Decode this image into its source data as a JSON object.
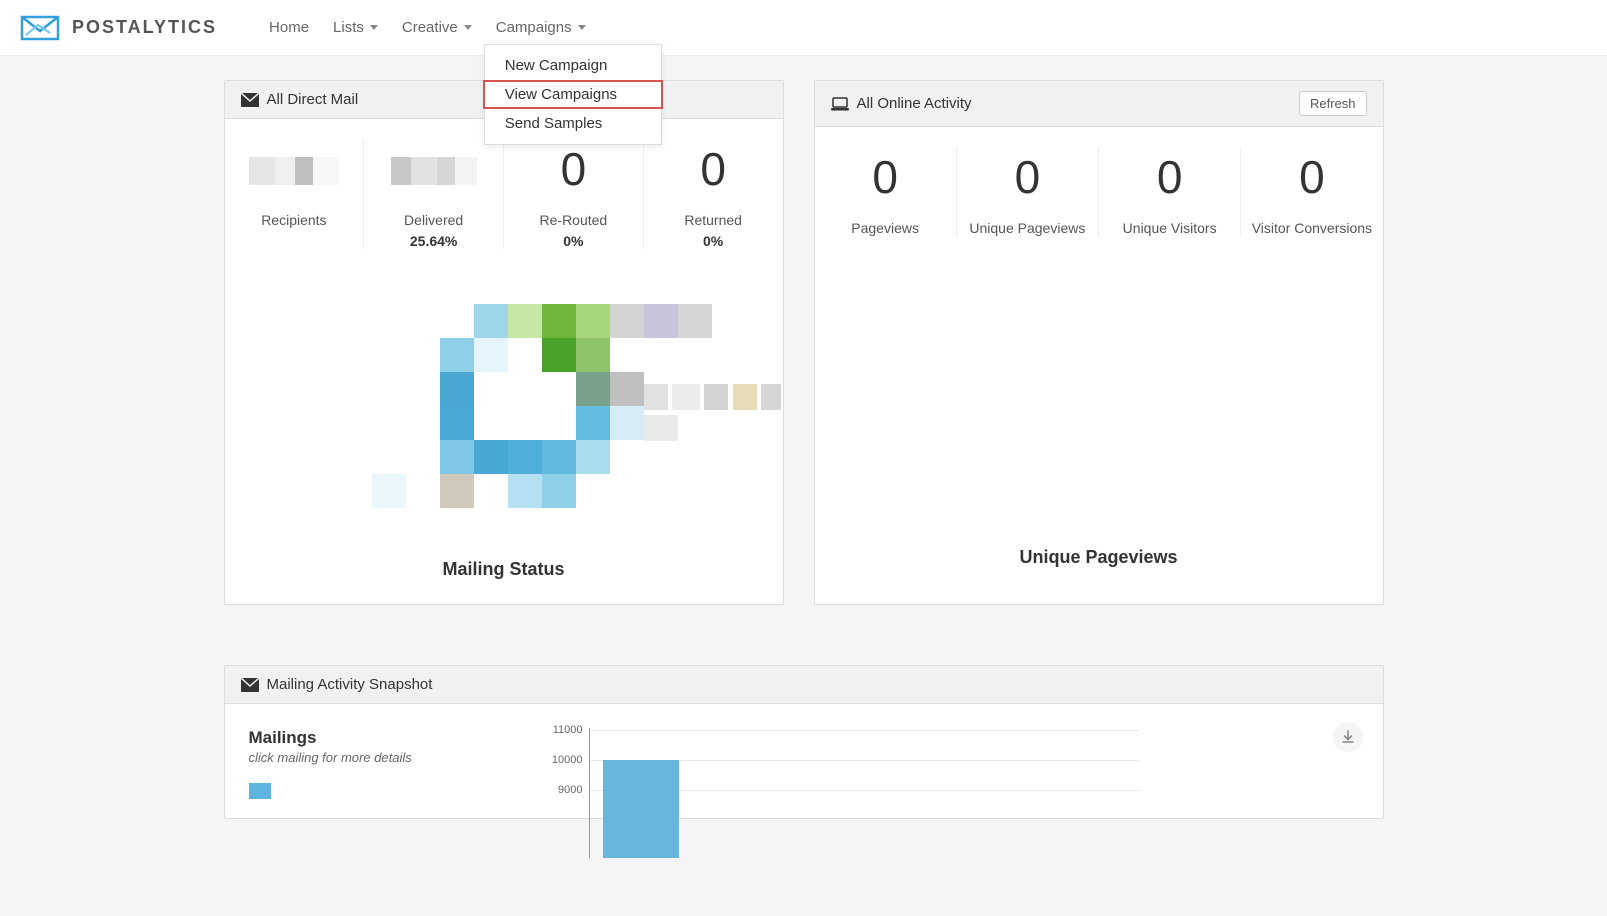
{
  "brand": "POSTALYTICS",
  "nav": {
    "items": [
      {
        "label": "Home",
        "has_caret": false
      },
      {
        "label": "Lists",
        "has_caret": true
      },
      {
        "label": "Creative",
        "has_caret": true
      },
      {
        "label": "Campaigns",
        "has_caret": true
      }
    ],
    "campaigns_dropdown": [
      {
        "label": "New Campaign"
      },
      {
        "label": "View Campaigns",
        "highlighted": true
      },
      {
        "label": "Send Samples"
      }
    ]
  },
  "panels": {
    "direct_mail": {
      "title": "All Direct Mail",
      "stats": [
        {
          "label": "Recipients",
          "value": "",
          "sub": "",
          "blurred": true
        },
        {
          "label": "Delivered",
          "value": "",
          "sub": "25.64%",
          "blurred": true
        },
        {
          "label": "Re-Routed",
          "value": "0",
          "sub": "0%"
        },
        {
          "label": "Returned",
          "value": "0",
          "sub": "0%"
        }
      ],
      "chart_title": "Mailing Status"
    },
    "online": {
      "title": "All Online Activity",
      "refresh": "Refresh",
      "stats": [
        {
          "label": "Pageviews",
          "value": "0"
        },
        {
          "label": "Unique Pageviews",
          "value": "0"
        },
        {
          "label": "Unique Visitors",
          "value": "0"
        },
        {
          "label": "Visitor Conversions",
          "value": "0"
        }
      ],
      "chart_title": "Unique Pageviews"
    },
    "snapshot": {
      "title": "Mailing Activity Snapshot",
      "mailings_heading": "Mailings",
      "mailings_sub": "click mailing for more details"
    }
  },
  "chart_data": {
    "type": "bar",
    "categories": [
      ""
    ],
    "values": [
      10000
    ],
    "y_ticks": [
      11000,
      10000,
      9000
    ],
    "title": "Mailing Activity Snapshot",
    "xlabel": "",
    "ylabel": "",
    "ylim": [
      0,
      11000
    ]
  },
  "colors": {
    "accent": "#33a1d9",
    "highlight_border": "#d9534f",
    "bar": "#67b7dc"
  }
}
